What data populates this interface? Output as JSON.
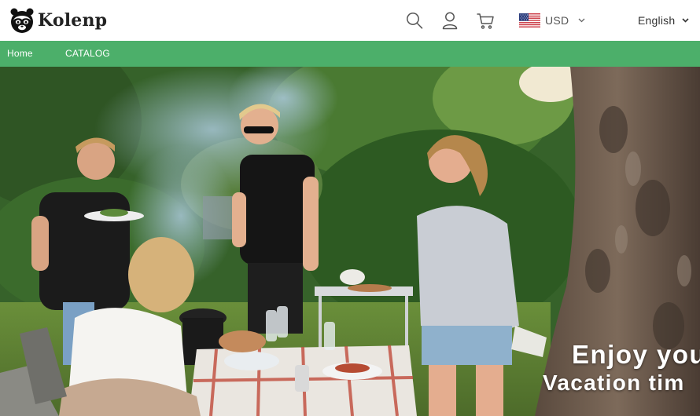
{
  "header": {
    "brand": "Kolenp",
    "icons": [
      "search-icon",
      "account-icon",
      "cart-icon"
    ],
    "currency": {
      "code": "USD",
      "flag": "us-flag-icon"
    },
    "language": "English"
  },
  "nav": {
    "items": [
      {
        "label": "Home"
      },
      {
        "label": "CATALOG"
      }
    ]
  },
  "hero": {
    "image": "family-barbecue-in-garden-photo",
    "title": "Enjoy you",
    "subtitle": "Vacation tim"
  },
  "colors": {
    "nav_background": "#4caf6a",
    "header_background": "#ffffff",
    "hero_text": "#ffffff"
  }
}
